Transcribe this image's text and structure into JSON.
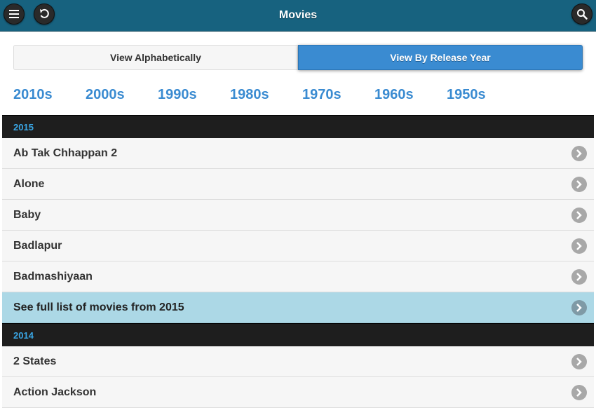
{
  "header": {
    "title": "Movies",
    "menu_icon": "menu-icon",
    "back_icon": "back-icon",
    "search_icon": "search-icon"
  },
  "view_toggle": {
    "alphabetical_label": "View Alphabetically",
    "release_year_label": "View By Release Year",
    "selected": "View By Release Year"
  },
  "decades": [
    "2010s",
    "2000s",
    "1990s",
    "1980s",
    "1970s",
    "1960s",
    "1950s"
  ],
  "sections": [
    {
      "year": "2015",
      "movies": [
        "Ab Tak Chhappan 2",
        "Alone",
        "Baby",
        "Badlapur",
        "Badmashiyaan"
      ],
      "more_label": "See full list of movies from 2015"
    },
    {
      "year": "2014",
      "movies": [
        "2 States",
        "Action Jackson"
      ]
    }
  ],
  "colors": {
    "header_bg": "#17627f",
    "accent": "#3a8bd1",
    "divider_bg": "#1e1e1e",
    "divider_text": "#3aa7e6",
    "more_bg": "#acd8e6"
  }
}
